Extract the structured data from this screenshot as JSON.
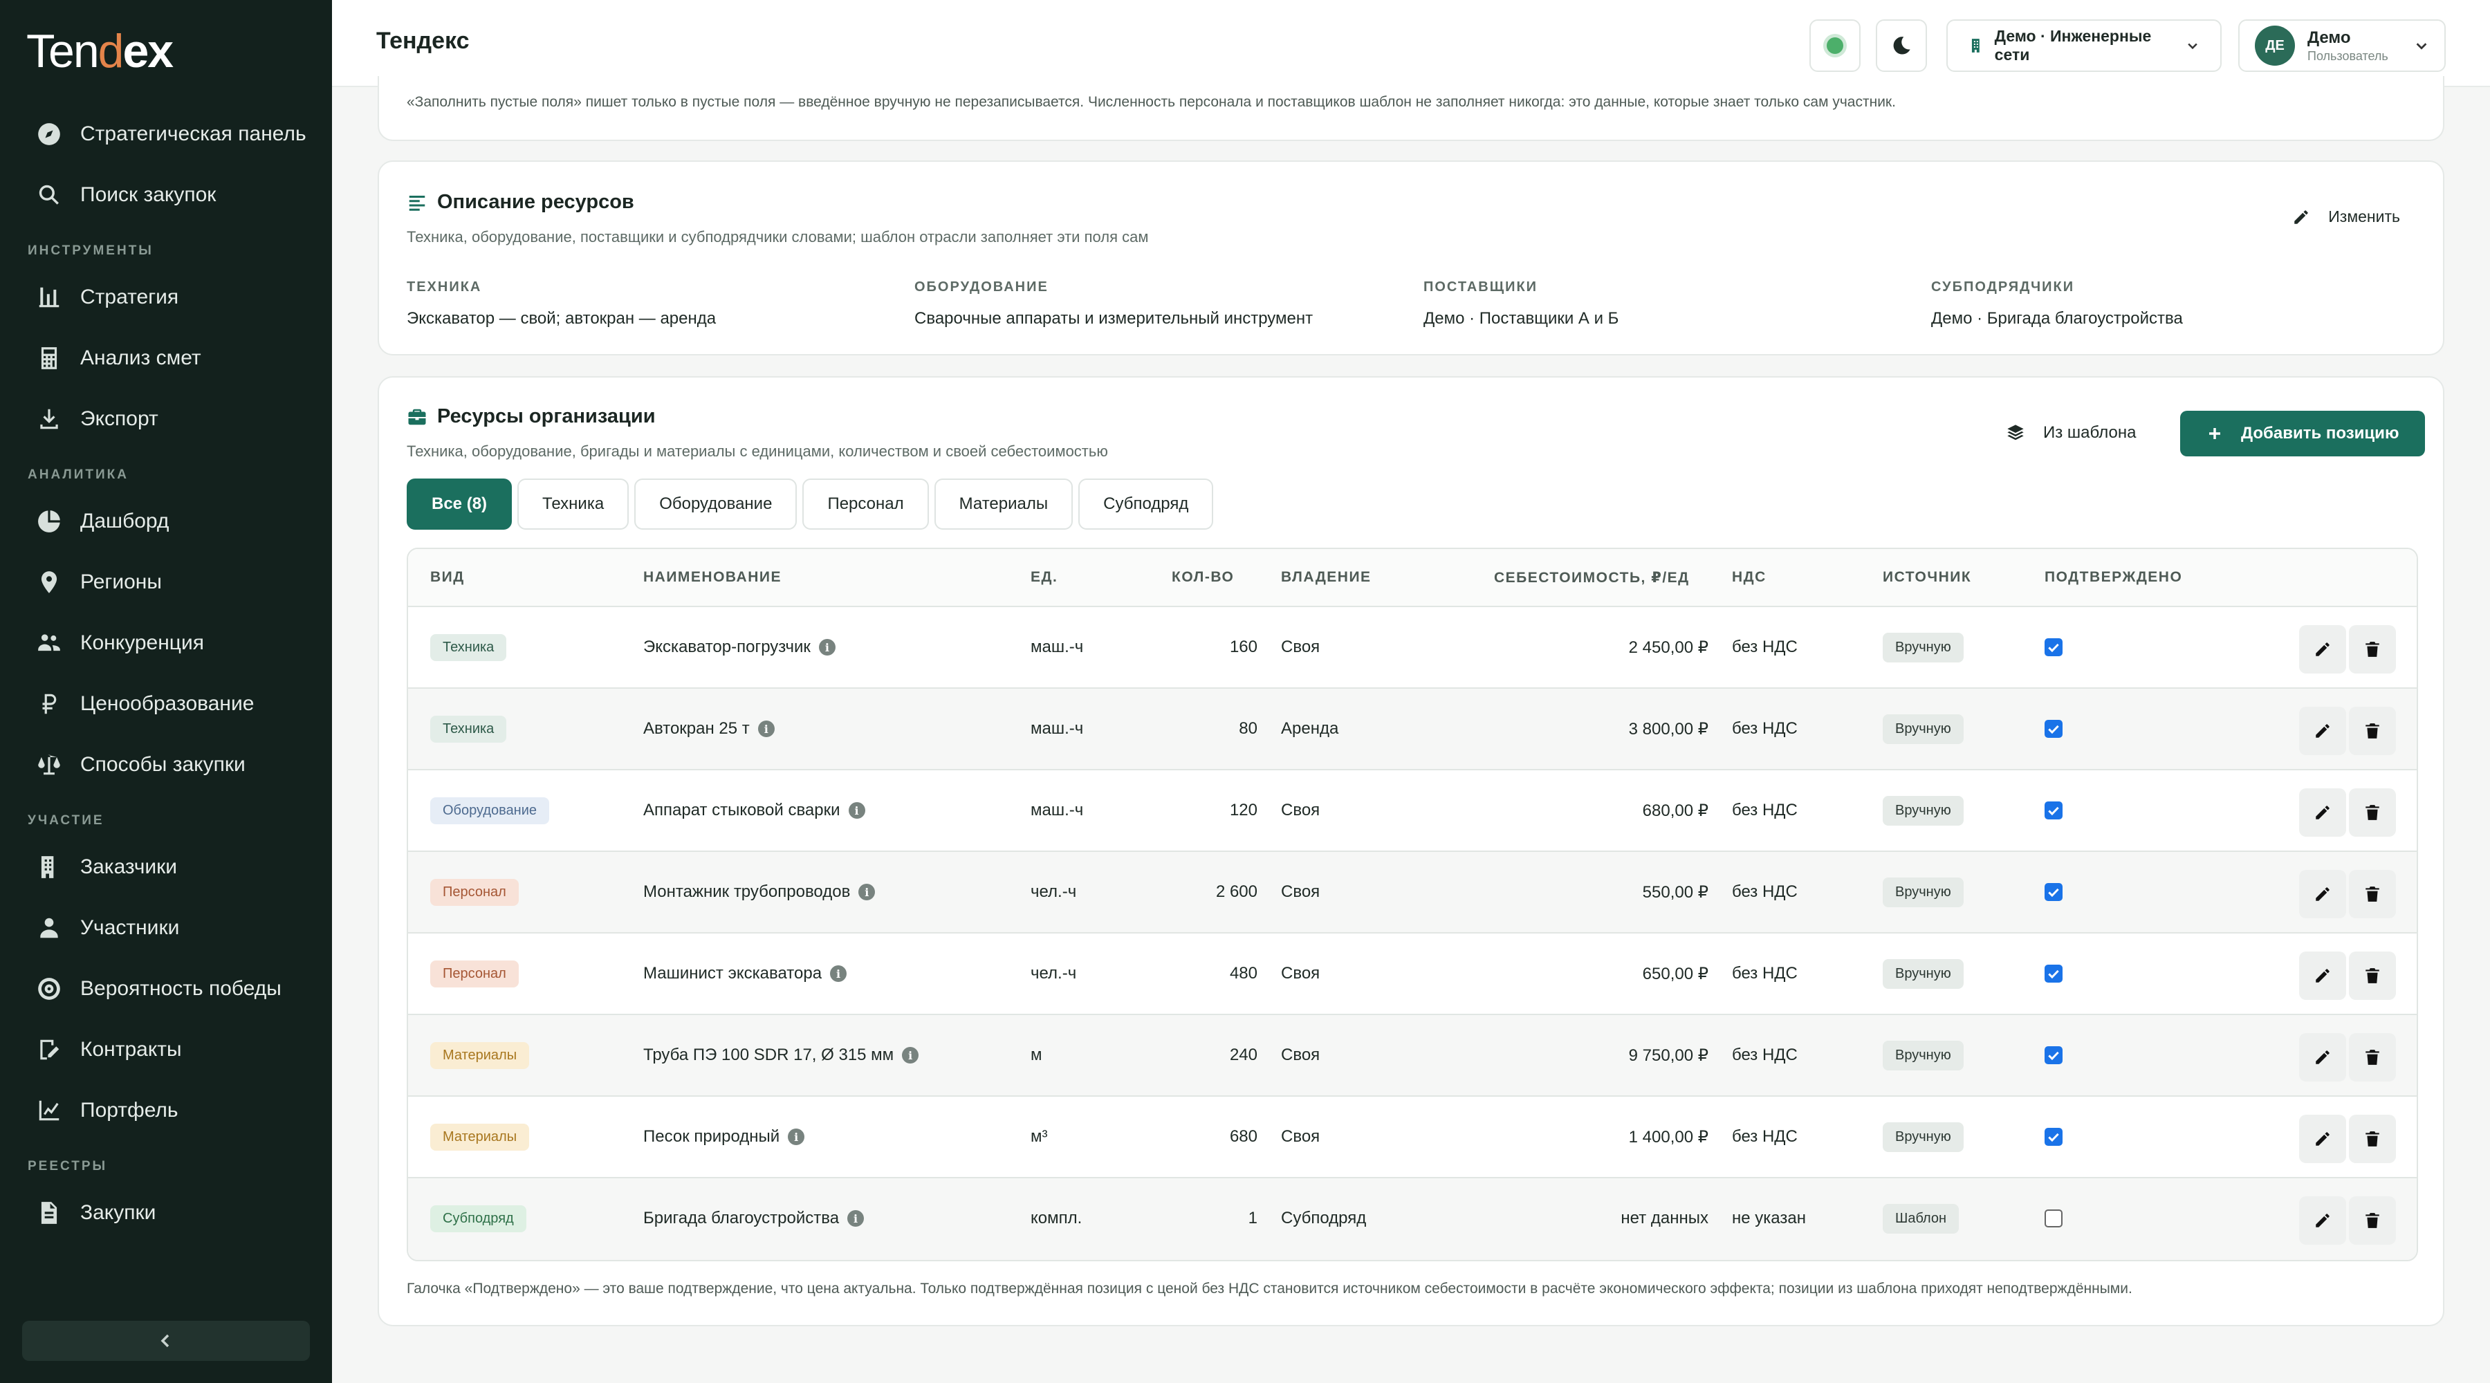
{
  "app": {
    "logo": "Tendex",
    "page_title": "Тендекс"
  },
  "sidebar": {
    "top_items": [
      {
        "label": "Стратегическая панель",
        "icon": "compass-icon"
      },
      {
        "label": "Поиск закупок",
        "icon": "search-icon"
      }
    ],
    "sections": [
      {
        "title": "ИНСТРУМЕНТЫ",
        "items": [
          {
            "label": "Стратегия",
            "icon": "strategy-icon"
          },
          {
            "label": "Анализ смет",
            "icon": "calculator-icon"
          },
          {
            "label": "Экспорт",
            "icon": "download-icon"
          }
        ]
      },
      {
        "title": "АНАЛИТИКА",
        "items": [
          {
            "label": "Дашборд",
            "icon": "pie-chart-icon"
          },
          {
            "label": "Регионы",
            "icon": "map-pin-icon"
          },
          {
            "label": "Конкуренция",
            "icon": "users-icon"
          },
          {
            "label": "Ценообразование",
            "icon": "ruble-icon"
          },
          {
            "label": "Способы закупки",
            "icon": "scales-icon"
          }
        ]
      },
      {
        "title": "УЧАСТИЕ",
        "items": [
          {
            "label": "Заказчики",
            "icon": "building-icon"
          },
          {
            "label": "Участники",
            "icon": "user-icon"
          },
          {
            "label": "Вероятность победы",
            "icon": "target-icon"
          },
          {
            "label": "Контракты",
            "icon": "contract-icon"
          },
          {
            "label": "Портфель",
            "icon": "portfolio-chart-icon"
          }
        ]
      },
      {
        "title": "РЕЕСТРЫ",
        "items": [
          {
            "label": "Закупки",
            "icon": "document-icon"
          }
        ]
      }
    ]
  },
  "header": {
    "org_label": "Демо · Инженерные сети",
    "user": {
      "initials": "ДЕ",
      "name": "Демо",
      "role": "Пользователь"
    }
  },
  "top_note": "«Заполнить пустые поля» пишет только в пустые поля — введённое вручную не перезаписывается. Численность персонала и поставщиков шаблон не заполняет никогда: это данные, которые знает только сам участник.",
  "description": {
    "title": "Описание ресурсов",
    "subtitle": "Техника, оборудование, поставщики и субподрядчики словами; шаблон отрасли заполняет эти поля сам",
    "edit_label": "Изменить",
    "fields": [
      {
        "label": "ТЕХНИКА",
        "value": "Экскаватор — свой; автокран — аренда"
      },
      {
        "label": "ОБОРУДОВАНИЕ",
        "value": "Сварочные аппараты и измерительный инструмент"
      },
      {
        "label": "ПОСТАВЩИКИ",
        "value": "Демо · Поставщики А и Б"
      },
      {
        "label": "СУБПОДРЯДЧИКИ",
        "value": "Демо · Бригада благоустройства"
      }
    ]
  },
  "resources": {
    "title": "Ресурсы организации",
    "subtitle": "Техника, оборудование, бригады и материалы с единицами, количеством и своей себестоимостью",
    "template_btn": "Из шаблона",
    "add_btn": "Добавить позицию",
    "tabs": [
      "Все (8)",
      "Техника",
      "Оборудование",
      "Персонал",
      "Материалы",
      "Субподряд"
    ],
    "columns": [
      "ВИД",
      "НАИМЕНОВАНИЕ",
      "ЕД.",
      "КОЛ-ВО",
      "ВЛАДЕНИЕ",
      "СЕБЕСТОИМОСТЬ, ₽/ЕД",
      "НДС",
      "ИСТОЧНИК",
      "ПОДТВЕРЖДЕНО"
    ],
    "rows": [
      {
        "kind": "Техника",
        "kind_class": "b-tech",
        "name": "Экскаватор-погрузчик",
        "unit": "маш.-ч",
        "qty": "160",
        "own": "Своя",
        "cost": "2 450,00 ₽",
        "vat": "без НДС",
        "source": "Вручную",
        "confirmed": true
      },
      {
        "kind": "Техника",
        "kind_class": "b-tech",
        "name": "Автокран 25 т",
        "unit": "маш.-ч",
        "qty": "80",
        "own": "Аренда",
        "cost": "3 800,00 ₽",
        "vat": "без НДС",
        "source": "Вручную",
        "confirmed": true
      },
      {
        "kind": "Оборудование",
        "kind_class": "b-equip",
        "name": "Аппарат стыковой сварки",
        "unit": "маш.-ч",
        "qty": "120",
        "own": "Своя",
        "cost": "680,00 ₽",
        "vat": "без НДС",
        "source": "Вручную",
        "confirmed": true
      },
      {
        "kind": "Персонал",
        "kind_class": "b-pers",
        "name": "Монтажник трубопроводов",
        "unit": "чел.-ч",
        "qty": "2 600",
        "own": "Своя",
        "cost": "550,00 ₽",
        "vat": "без НДС",
        "source": "Вручную",
        "confirmed": true
      },
      {
        "kind": "Персонал",
        "kind_class": "b-pers",
        "name": "Машинист экскаватора",
        "unit": "чел.-ч",
        "qty": "480",
        "own": "Своя",
        "cost": "650,00 ₽",
        "vat": "без НДС",
        "source": "Вручную",
        "confirmed": true
      },
      {
        "kind": "Материалы",
        "kind_class": "b-mat",
        "name": "Труба ПЭ 100 SDR 17, Ø 315 мм",
        "unit": "м",
        "qty": "240",
        "own": "Своя",
        "cost": "9 750,00 ₽",
        "vat": "без НДС",
        "source": "Вручную",
        "confirmed": true
      },
      {
        "kind": "Материалы",
        "kind_class": "b-mat",
        "name": "Песок природный",
        "unit": "м³",
        "qty": "680",
        "own": "Своя",
        "cost": "1 400,00 ₽",
        "vat": "без НДС",
        "source": "Вручную",
        "confirmed": true
      },
      {
        "kind": "Субподряд",
        "kind_class": "b-sub",
        "name": "Бригада благоустройства",
        "unit": "компл.",
        "qty": "1",
        "own": "Субподряд",
        "cost": "нет данных",
        "vat": "не указан",
        "source": "Шаблон",
        "confirmed": false
      }
    ],
    "footnote": "Галочка «Подтверждено» — это ваше подтверждение, что цена актуальна. Только подтверждённая позиция с ценой без НДС становится источником себестоимости в расчёте экономического эффекта; позиции из шаблона приходят неподтверждёнными."
  },
  "colors": {
    "sidebar_bg": "#13211d",
    "accent": "#1b6f5e",
    "logo_accent": "#e4844a",
    "checkbox": "#1a73e8"
  }
}
